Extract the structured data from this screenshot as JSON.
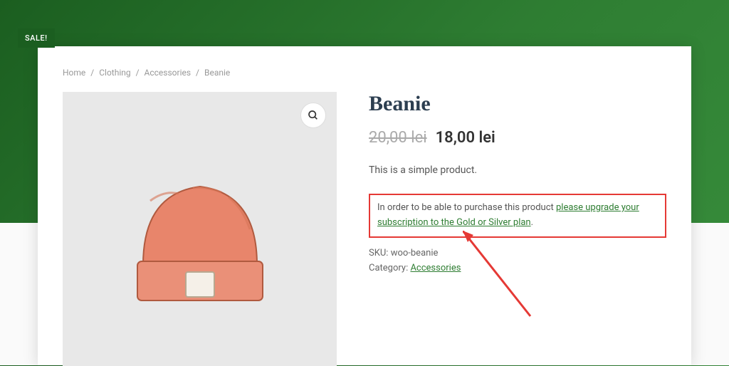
{
  "sale_badge": "SALE!",
  "breadcrumb": {
    "home": "Home",
    "cat1": "Clothing",
    "cat2": "Accessories",
    "current": "Beanie"
  },
  "product": {
    "title": "Beanie",
    "old_price": "20,00 lei",
    "new_price": "18,00 lei",
    "description": "This is a simple product.",
    "upgrade_prefix": "In order to be able to purchase this product ",
    "upgrade_link": "please upgrade your subscription to the Gold or Silver plan",
    "upgrade_suffix": ".",
    "sku_label": "SKU: ",
    "sku_value": "woo-beanie",
    "category_label": "Category: ",
    "category_value": "Accessories"
  }
}
